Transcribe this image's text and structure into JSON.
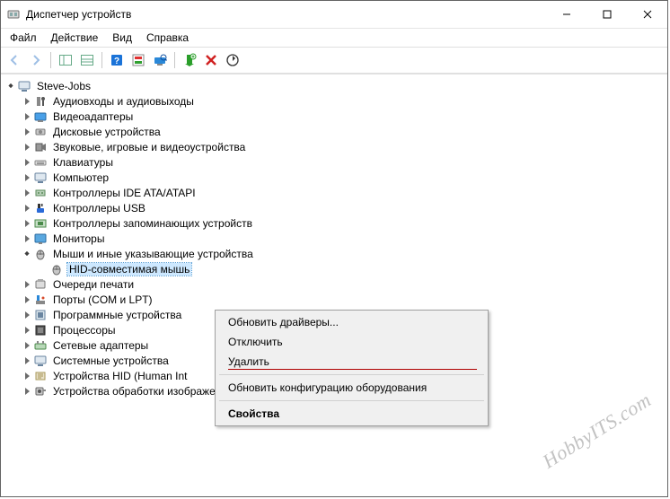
{
  "window": {
    "title": "Диспетчер устройств"
  },
  "menu": {
    "file": "Файл",
    "action": "Действие",
    "view": "Вид",
    "help": "Справка"
  },
  "tree": {
    "root": "Steve-Jobs",
    "nodes": [
      "Аудиовходы и аудиовыходы",
      "Видеоадаптеры",
      "Дисковые устройства",
      "Звуковые, игровые и видеоустройства",
      "Клавиатуры",
      "Компьютер",
      "Контроллеры IDE ATA/ATAPI",
      "Контроллеры USB",
      "Контроллеры запоминающих устройств",
      "Мониторы",
      "Мыши и иные указывающие устройства",
      "Очереди печати",
      "Порты (COM и LPT)",
      "Программные устройства",
      "Процессоры",
      "Сетевые адаптеры",
      "Системные устройства",
      "Устройства HID (Human Int",
      "Устройства обработки изображений"
    ],
    "mouse_child": "HID-совместимая мышь"
  },
  "context_menu": {
    "update": "Обновить драйверы...",
    "disable": "Отключить",
    "delete": "Удалить",
    "scan": "Обновить конфигурацию оборудования",
    "properties": "Свойства"
  },
  "watermark": "HobbyITS.com"
}
